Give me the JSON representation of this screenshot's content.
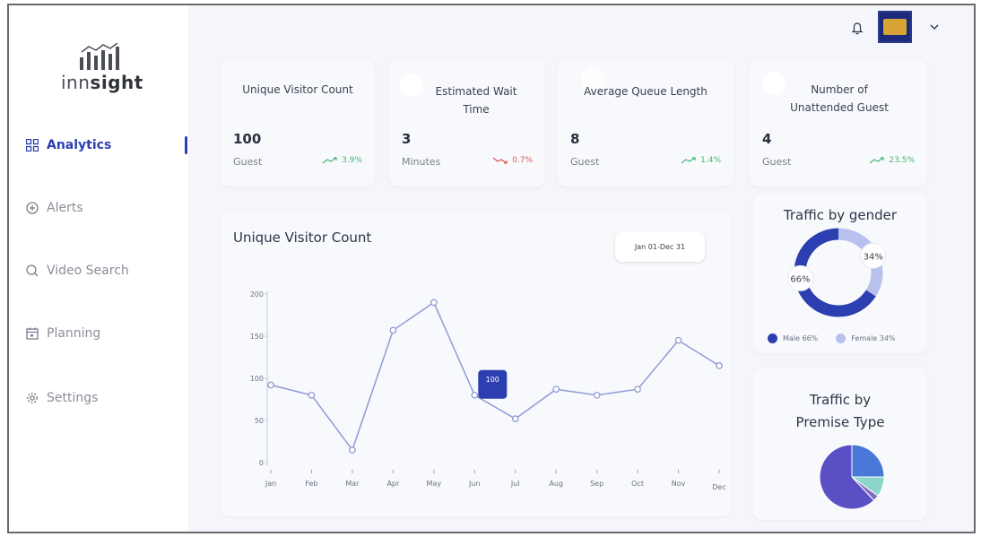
{
  "brand": {
    "name_light": "inn",
    "name_bold": "sight"
  },
  "colors": {
    "primary": "#2c3fb0",
    "secondary": "#b8c1ee",
    "line": "#8f9bd6",
    "up": "#46b877",
    "down": "#e0574f"
  },
  "sidebar": {
    "items": [
      {
        "label": "Analytics",
        "icon": "analytics-grid-icon",
        "active": true
      },
      {
        "label": "Alerts",
        "icon": "plus-circle-icon"
      },
      {
        "label": "Video Search",
        "icon": "search-icon"
      },
      {
        "label": "Planning",
        "icon": "calendar-icon"
      },
      {
        "label": "Settings",
        "icon": "gear-icon"
      }
    ]
  },
  "topbar": {
    "bell_icon": "bell-icon",
    "avatar_icon": "hotel-logo-avatar",
    "chevron_icon": "chevron-down-icon"
  },
  "kpis": [
    {
      "title": "Unique Visitor Count",
      "value": "100",
      "unit": "Guest",
      "trend": "3.9%",
      "direction": "up"
    },
    {
      "title": "Estimated Wait Time",
      "value": "3",
      "unit": "Minutes",
      "trend": "0.7%",
      "direction": "down"
    },
    {
      "title": "Average Queue Length",
      "value": "8",
      "unit": "Guest",
      "trend": "1.4%",
      "direction": "up"
    },
    {
      "title": "Number of Unattended Guest",
      "value": "4",
      "unit": "Guest",
      "trend": "23.5%",
      "direction": "up"
    }
  ],
  "visitor_chart": {
    "title": "Unique Visitor Count",
    "date_range": "Jan 01-Dec 31",
    "tooltip": "100"
  },
  "gender": {
    "title": "Traffic by gender",
    "male_label": "66%",
    "female_label": "34%",
    "legend_male": "Male 66%",
    "legend_female": "Female 34%"
  },
  "premise": {
    "title_line1": "Traffic by",
    "title_line2": "Premise Type"
  },
  "chart_data": [
    {
      "type": "line",
      "title": "Unique Visitor Count",
      "categories": [
        "Jan",
        "Feb",
        "Mar",
        "Apr",
        "May",
        "Jun",
        "Jul",
        "Aug",
        "Sep",
        "Oct",
        "Nov",
        "Dec"
      ],
      "values": [
        92,
        80,
        15,
        157,
        190,
        80,
        52,
        87,
        80,
        87,
        145,
        115
      ],
      "ylim": [
        0,
        200
      ],
      "yticks": [
        0,
        50,
        100,
        150,
        200
      ],
      "highlight": {
        "category": "Jun",
        "label": "100"
      },
      "grid": false
    },
    {
      "type": "pie",
      "title": "Traffic by gender",
      "series": [
        {
          "name": "Male",
          "values": [
            66
          ]
        },
        {
          "name": "Female",
          "values": [
            34
          ]
        }
      ],
      "legend": "bottom"
    },
    {
      "type": "pie",
      "title": "Traffic by Premise Type",
      "values": [
        25,
        10,
        3,
        62
      ],
      "colors": [
        "#4a78d8",
        "#8bd6c8",
        "#7f69c9",
        "#5a4fc4"
      ],
      "legend": "none"
    }
  ]
}
